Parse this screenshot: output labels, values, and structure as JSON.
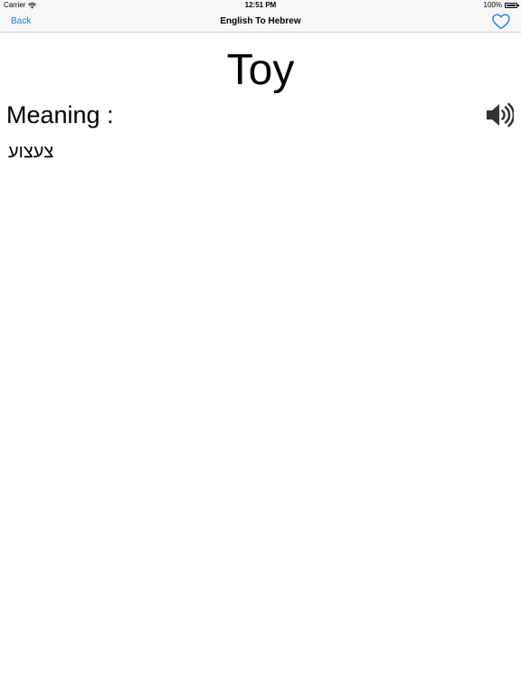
{
  "status_bar": {
    "carrier": "Carrier",
    "time": "12:51 PM",
    "battery": "100%",
    "wifi_icon": "wifi-icon",
    "battery_icon": "battery-icon"
  },
  "nav": {
    "back_label": "Back",
    "title": "English To Hebrew",
    "favorite_icon": "heart-icon",
    "accent_color": "#1a7cf6"
  },
  "content": {
    "word": "Toy",
    "meaning_label": "Meaning :",
    "translation": "צעצוע",
    "speaker_icon": "speaker-icon"
  }
}
